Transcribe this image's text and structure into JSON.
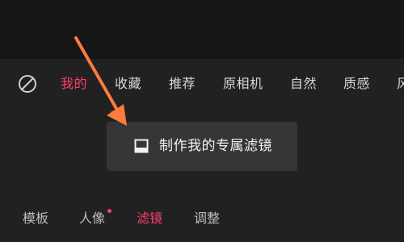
{
  "filter_categories": {
    "items": [
      {
        "label": "我的",
        "active": true
      },
      {
        "label": "收藏",
        "active": false
      },
      {
        "label": "推荐",
        "active": false
      },
      {
        "label": "原相机",
        "active": false
      },
      {
        "label": "自然",
        "active": false
      },
      {
        "label": "质感",
        "active": false
      },
      {
        "label": "风",
        "active": false
      }
    ]
  },
  "make_filter_button": {
    "label": "制作我的专属滤镜",
    "icon": "square-frame-icon"
  },
  "bottom_tabs": {
    "items": [
      {
        "label": "模板",
        "active": false
      },
      {
        "label": "人像",
        "active": false,
        "has_dot": true
      },
      {
        "label": "滤镜",
        "active": true
      },
      {
        "label": "调整",
        "active": false
      }
    ]
  },
  "colors": {
    "accent": "#ff3e6a",
    "annotation_arrow": "#ff7a3d",
    "panel_bg": "#212121",
    "button_bg": "#363636"
  }
}
